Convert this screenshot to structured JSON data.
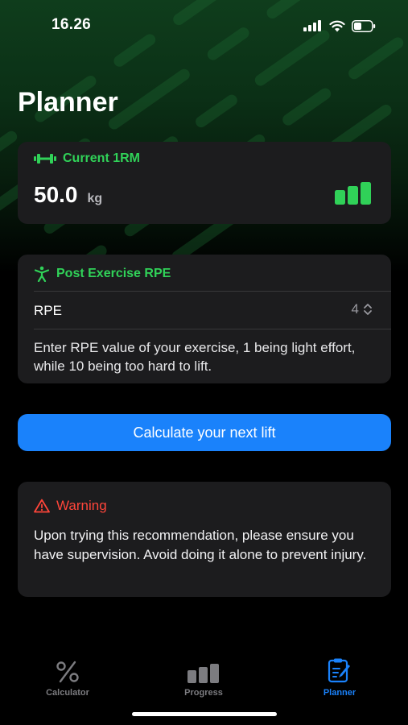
{
  "status_bar": {
    "time": "16.26",
    "icons": [
      "signal-icon",
      "wifi-icon",
      "battery-icon"
    ]
  },
  "page": {
    "title": "Planner"
  },
  "one_rm_card": {
    "title": "Current 1RM",
    "icon": "dumbbell-icon",
    "value": "50.0",
    "unit": "kg",
    "trailing_icon": "progress-bars-icon"
  },
  "rpe_card": {
    "title": "Post Exercise RPE",
    "icon": "figure-exercise-icon",
    "row_label": "RPE",
    "row_value": "4",
    "stepper_icon": "chevron-up-down-icon",
    "help": "Enter RPE value of your exercise, 1 being light effort, while 10 being too hard to lift."
  },
  "cta": {
    "label": "Calculate your next lift"
  },
  "warning_card": {
    "title": "Warning",
    "icon": "warning-triangle-icon",
    "text": "Upon trying this recommendation, please ensure you have supervision. Avoid doing it alone to prevent injury."
  },
  "tab_bar": {
    "tabs": [
      {
        "label": "Calculator",
        "icon": "percent-icon",
        "active": false
      },
      {
        "label": "Progress",
        "icon": "bar-chart-icon",
        "active": false
      },
      {
        "label": "Planner",
        "icon": "clipboard-edit-icon",
        "active": true
      }
    ]
  },
  "colors": {
    "accent_green": "#30d158",
    "accent_blue": "#1a82fb",
    "warning_red": "#ff453a",
    "card_background": "#1c1c1e",
    "inactive_tab": "#7c7c80"
  }
}
